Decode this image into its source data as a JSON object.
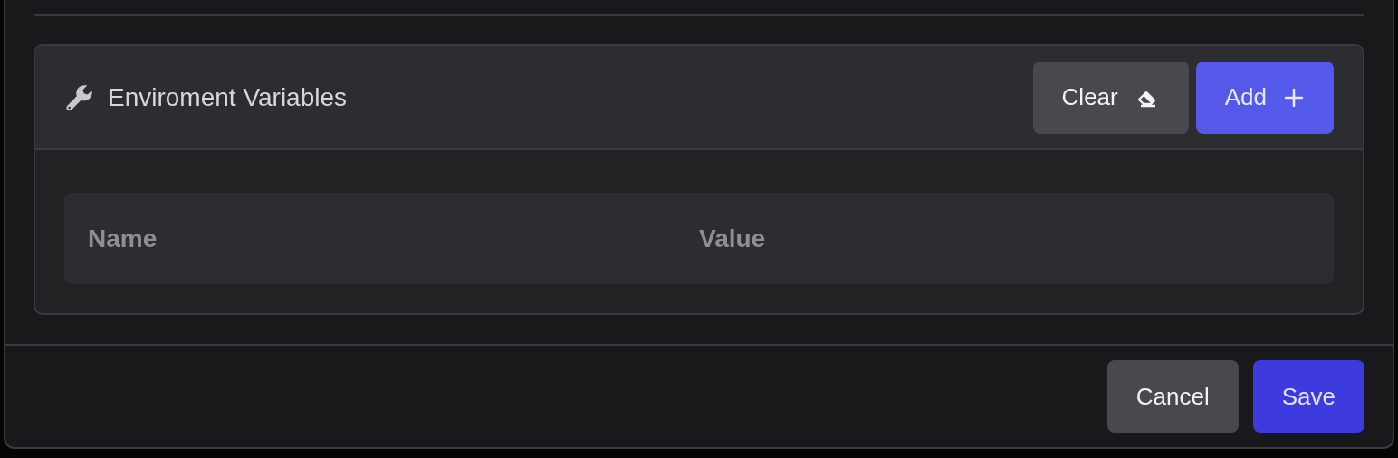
{
  "section": {
    "title": "Enviroment Variables",
    "buttons": [
      {
        "label": "Clear",
        "kind": "clear"
      },
      {
        "label": "Add",
        "kind": "add"
      }
    ],
    "table": {
      "columns": [
        "Name",
        "Value"
      ]
    }
  },
  "footer": {
    "buttons": [
      {
        "label": "Cancel",
        "kind": "cancel"
      },
      {
        "label": "Save",
        "kind": "save"
      }
    ]
  }
}
